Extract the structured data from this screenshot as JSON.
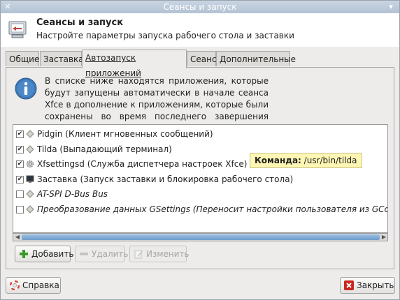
{
  "window": {
    "title": "Сеансы и запуск"
  },
  "header": {
    "title": "Сеансы и запуск",
    "subtitle": "Настройте параметры запуска рабочего стола и заставки"
  },
  "tabs": [
    {
      "label": "Общие",
      "active": false
    },
    {
      "label": "Заставка",
      "active": false
    },
    {
      "label": "Автозапуск приложений",
      "active": true
    },
    {
      "label": "Сеанс",
      "active": false
    },
    {
      "label": "Дополнительные",
      "active": false
    }
  ],
  "info": {
    "text": "В списке ниже находятся приложения, которые будут запущены автоматически в начале сеанса Xfce в дополнение к приложениям, которые были сохранены во время последнего завершения сеанса:"
  },
  "apps": [
    {
      "label": "Pidgin (Клиент мгновенных сообщений)",
      "checked": true,
      "italic": false,
      "icon": "diamond-icon"
    },
    {
      "label": "Tilda (Выпадающий терминал)",
      "checked": true,
      "italic": false,
      "icon": "diamond-icon"
    },
    {
      "label": "Xfsettingsd (Служба диспетчера настроек Xfce)",
      "checked": true,
      "italic": false,
      "icon": "gear-icon"
    },
    {
      "label": "Заставка (Запуск заставки и блокировка рабочего стола)",
      "checked": true,
      "italic": false,
      "icon": "screensaver-icon"
    },
    {
      "label": "AT-SPI D-Bus Bus",
      "checked": false,
      "italic": true,
      "icon": "diamond-icon"
    },
    {
      "label": "Преобразование данных GSettings (Переносит настройки пользователя из GConf в dco",
      "checked": false,
      "italic": true,
      "icon": "diamond-icon"
    }
  ],
  "tooltip": {
    "label": "Команда:",
    "value": "/usr/bin/tilda"
  },
  "buttons": {
    "add": "Добавить",
    "remove": "Удалить",
    "edit": "Изменить",
    "help": "Справка",
    "close": "Закрыть"
  },
  "colors": {
    "add_icon": "#3a9a2a",
    "help_icon": "#d8422e",
    "close_icon": "#c8281e",
    "info_icon": "#3e78b6"
  }
}
